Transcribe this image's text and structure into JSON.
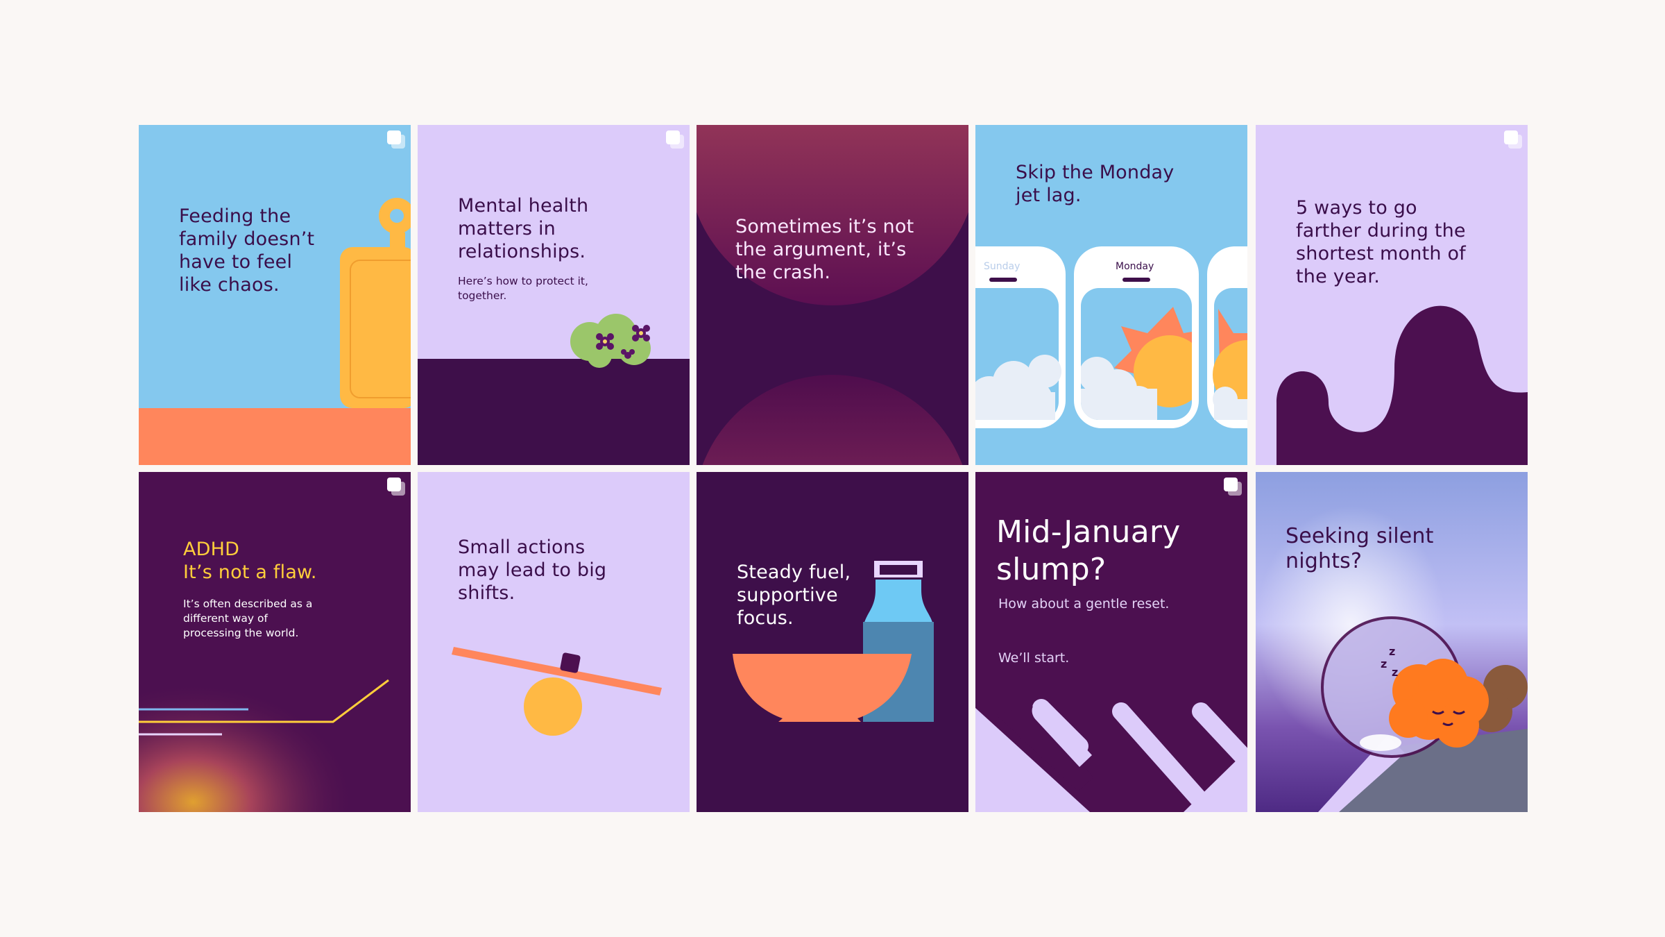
{
  "tiles": [
    {
      "id": "family",
      "text": "Feeding the family doesn’t have to feel like chaos.",
      "carousel": true
    },
    {
      "id": "mental-health",
      "text": "Mental health matters in relationships.",
      "subtext": "Here’s how to protect it, together.",
      "carousel": true
    },
    {
      "id": "argument",
      "text": "Sometimes it’s not the argument, it’s the crash.",
      "carousel": false
    },
    {
      "id": "jet-lag",
      "text": "Skip the Monday jet lag.",
      "windows": [
        "Sunday",
        "Monday"
      ],
      "carousel": false
    },
    {
      "id": "shortest-month",
      "text": "5 ways to go farther during the shortest month of the year.",
      "carousel": true
    },
    {
      "id": "adhd",
      "title": "ADHD",
      "highlight": "It’s not a flaw.",
      "subtext": "It’s often described as a different way of processing the world.",
      "carousel": true
    },
    {
      "id": "small-actions",
      "text": "Small actions may lead to big shifts.",
      "carousel": false
    },
    {
      "id": "steady-fuel",
      "text": "Steady fuel, supportive focus.",
      "carousel": false
    },
    {
      "id": "mid-january",
      "title": "Mid-January slump?",
      "subtext": "How about a gentle reset.",
      "note": "We’ll start.",
      "carousel": true
    },
    {
      "id": "silent-nights",
      "text": "Seeking silent nights?",
      "icon": "sleeping-zzz-icon",
      "carousel": false
    }
  ],
  "colors": {
    "sky_blue": "#84c8ee",
    "lavender": "#dccbfa",
    "deep_purple": "#3e0f4a",
    "plum": "#4c1050",
    "orange": "#ff865c",
    "yellow": "#ffb944",
    "ink": "#3a0e4a",
    "adhd_yellow": "#ffce3b"
  }
}
